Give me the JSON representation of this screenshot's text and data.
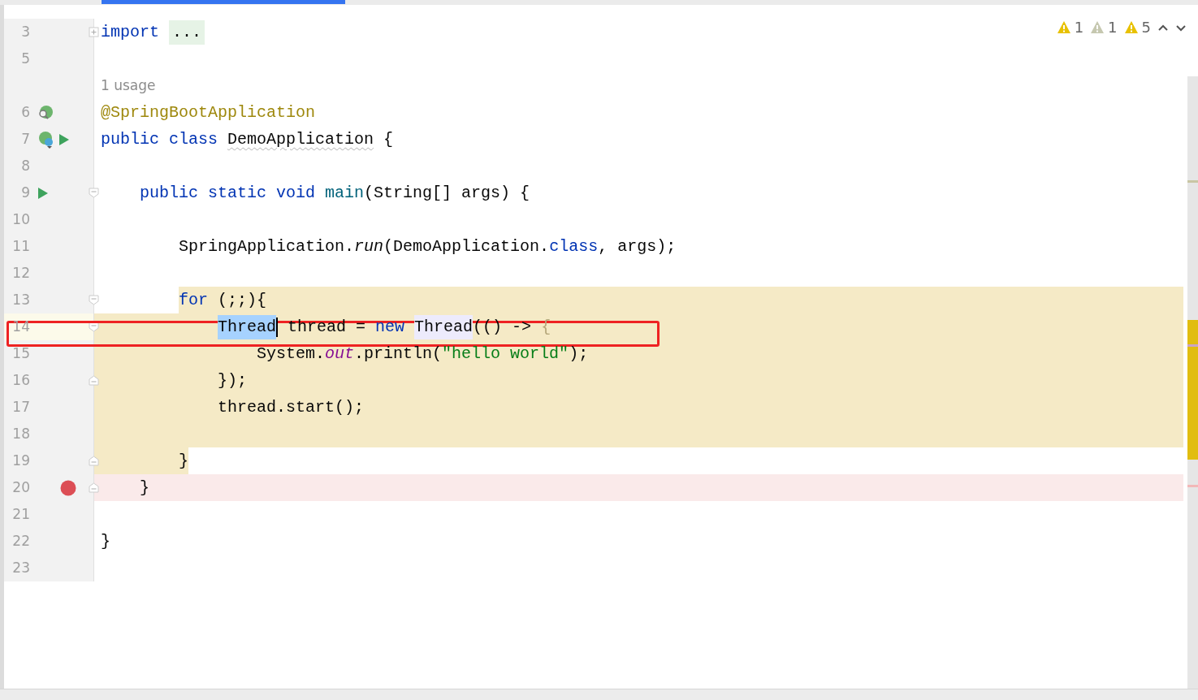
{
  "inspections": [
    {
      "count": "1",
      "color": "#e8c100"
    },
    {
      "count": "1",
      "color": "#c6c8b0"
    },
    {
      "count": "5",
      "color": "#e8c100"
    }
  ],
  "lines": [
    {
      "number": "3",
      "collapsed": true,
      "tokens": [
        {
          "kind": "keyword",
          "text": "import "
        },
        {
          "kind": "folded",
          "text": "..."
        }
      ]
    },
    {
      "number": "5"
    },
    {
      "kind": "hint",
      "text": "1 usage"
    },
    {
      "number": "6",
      "gutter": [
        {
          "kind": "bean"
        }
      ],
      "tokens": [
        {
          "kind": "annotation",
          "text": "@SpringBootApplication"
        }
      ]
    },
    {
      "number": "7",
      "gutter": [
        {
          "kind": "spring-class"
        },
        {
          "kind": "run"
        }
      ],
      "tokens": [
        {
          "kind": "keyword",
          "text": "public class "
        },
        {
          "kind": "wavy",
          "text": "DemoApplication"
        },
        {
          "kind": "plain",
          "text": " {"
        }
      ]
    },
    {
      "number": "8"
    },
    {
      "number": "9",
      "fold_start": true,
      "gutter": [
        {
          "kind": "run"
        }
      ],
      "tokens": [
        {
          "kind": "keyword",
          "text": "    public static void "
        },
        {
          "kind": "method-decl",
          "text": "main"
        },
        {
          "kind": "plain",
          "text": "(String[] args) {"
        }
      ]
    },
    {
      "number": "10"
    },
    {
      "number": "11",
      "tokens": [
        {
          "kind": "plain",
          "text": "        SpringApplication."
        },
        {
          "kind": "static-method",
          "text": "run"
        },
        {
          "kind": "plain",
          "text": "(DemoApplication."
        },
        {
          "kind": "keyword",
          "text": "class"
        },
        {
          "kind": "plain",
          "text": ", args);"
        }
      ]
    },
    {
      "number": "12"
    },
    {
      "number": "13",
      "fold_start": true,
      "highlighted": true,
      "tokens": [
        {
          "kind": "keyword",
          "text": "        for"
        },
        {
          "kind": "plain",
          "text": " (;;){"
        }
      ]
    },
    {
      "number": "14",
      "fold_start": true,
      "current": true,
      "highlighted": true,
      "annotation_box": true,
      "tokens": [
        {
          "kind": "selected",
          "text": "            Thread",
          "caret_after": true
        },
        {
          "kind": "plain",
          "text": " thread = "
        },
        {
          "kind": "keyword",
          "text": "new "
        },
        {
          "kind": "usage",
          "text": "Thread"
        },
        {
          "kind": "plain",
          "text": "(() -> "
        },
        {
          "kind": "faded",
          "text": "{"
        }
      ]
    },
    {
      "number": "15",
      "highlighted": true,
      "tokens": [
        {
          "kind": "plain",
          "text": "                System."
        },
        {
          "kind": "static-field",
          "text": "out"
        },
        {
          "kind": "plain",
          "text": ".println("
        },
        {
          "kind": "string",
          "text": "\"hello world\""
        },
        {
          "kind": "plain",
          "text": ");"
        }
      ]
    },
    {
      "number": "16",
      "fold_end": true,
      "highlighted": true,
      "tokens": [
        {
          "kind": "plain",
          "text": "            });"
        }
      ]
    },
    {
      "number": "17",
      "highlighted": true,
      "tokens": [
        {
          "kind": "plain",
          "text": "            thread.start();"
        }
      ]
    },
    {
      "number": "18",
      "highlighted": true
    },
    {
      "number": "19",
      "fold_end": true,
      "highlighted": true,
      "tokens": [
        {
          "kind": "plain",
          "text": "        }"
        }
      ]
    },
    {
      "number": "20",
      "fold_end": true,
      "breakpoint": true,
      "tokens": [
        {
          "kind": "plain",
          "text": "    }"
        }
      ]
    },
    {
      "number": "21"
    },
    {
      "number": "22",
      "tokens": [
        {
          "kind": "plain",
          "text": "}"
        }
      ]
    },
    {
      "number": "23"
    }
  ]
}
